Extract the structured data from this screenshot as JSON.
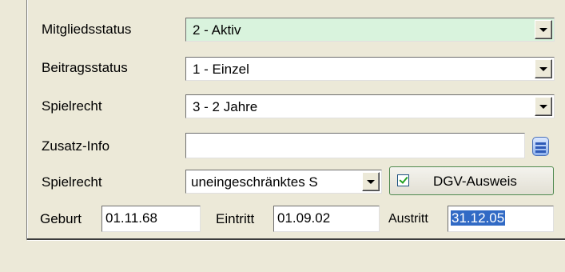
{
  "form": {
    "mitgliedsstatus": {
      "label": "Mitgliedsstatus",
      "value": "2 - Aktiv",
      "highlight_color": "#d9f3dd"
    },
    "beitragsstatus": {
      "label": "Beitragsstatus",
      "value": "1 - Einzel"
    },
    "spielrecht1": {
      "label": "Spielrecht",
      "value": "3 - 2 Jahre"
    },
    "zusatz_info": {
      "label": "Zusatz-Info",
      "value": ""
    },
    "spielrecht2": {
      "label": "Spielrecht",
      "value": "uneingeschränktes S"
    },
    "dgv_ausweis": {
      "label": "DGV-Ausweis",
      "checked": true
    },
    "geburt": {
      "label": "Geburt",
      "value": "01.11.68"
    },
    "eintritt": {
      "label": "Eintritt",
      "value": "01.09.02"
    },
    "austritt": {
      "label": "Austritt",
      "value": "31.12.05"
    }
  },
  "icons": {
    "dropdown": "chevron-down-icon",
    "lookup": "list-lookup-icon",
    "check": "checkmark-icon"
  }
}
